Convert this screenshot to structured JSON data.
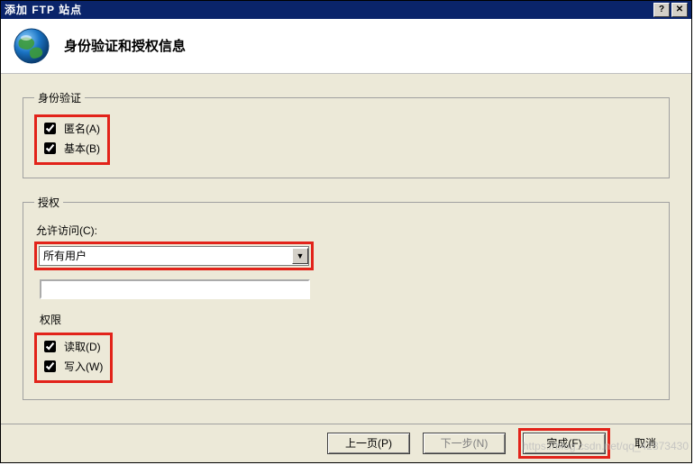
{
  "titlebar": {
    "title": "添加 FTP 站点"
  },
  "header": {
    "title": "身份验证和授权信息"
  },
  "auth_group": {
    "legend": "身份验证",
    "anonymous_label": "匿名(A)",
    "basic_label": "基本(B)"
  },
  "authorization_group": {
    "legend": "授权",
    "allow_access_label": "允许访问(C):",
    "allow_access_value": "所有用户",
    "permissions_label": "权限",
    "read_label": "读取(D)",
    "write_label": "写入(W)"
  },
  "footer": {
    "prev": "上一页(P)",
    "next": "下一步(N)",
    "finish": "完成(F)",
    "cancel": "取消"
  },
  "watermark": "https://blog.csdn.net/qq_42873430"
}
